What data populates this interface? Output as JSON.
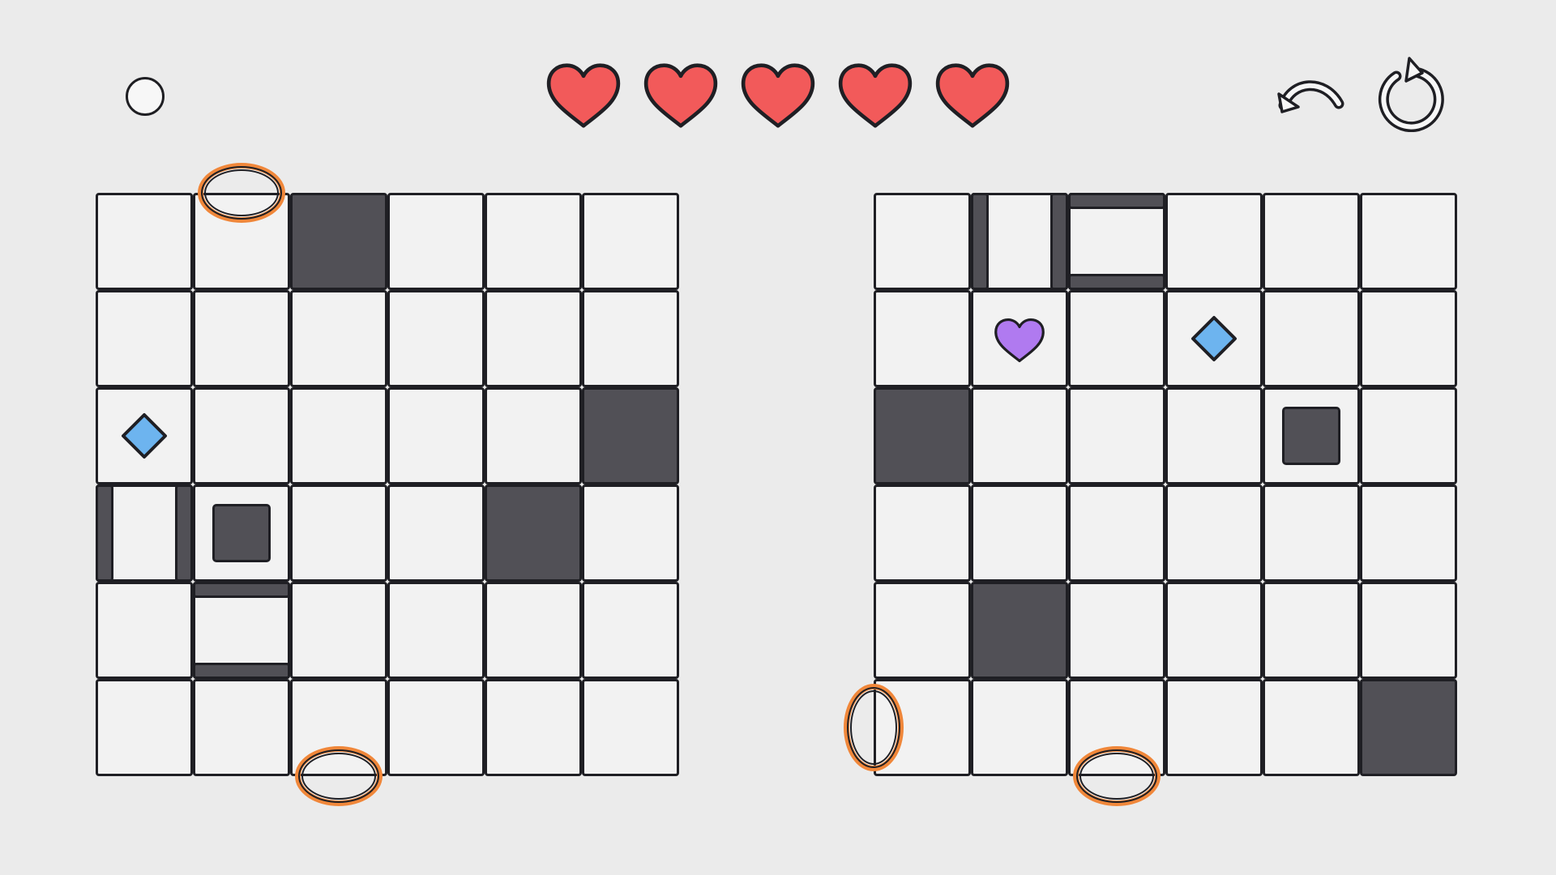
{
  "hud": {
    "indicator": "state-indicator",
    "lives": {
      "count": 5,
      "color": "#f25a5a",
      "icon": "heart-icon"
    },
    "undo": {
      "icon": "undo-icon"
    },
    "restart": {
      "icon": "restart-icon"
    }
  },
  "colors": {
    "background": "#ebebeb",
    "cell": "#f2f2f2",
    "dark_cell": "#515056",
    "outline": "#1f1f24",
    "portal": "#f0873a",
    "gem": "#6db4ef",
    "purple_heart": "#b07af0"
  },
  "boards": [
    {
      "rows": 6,
      "cols": 6,
      "dark_cells": [
        [
          0,
          2
        ],
        [
          2,
          5
        ],
        [
          3,
          4
        ]
      ],
      "boxes": [
        [
          3,
          1
        ]
      ],
      "gems": [
        [
          2,
          0
        ]
      ],
      "hearts": [],
      "walls": [
        {
          "row": 3,
          "col": 0,
          "side": "left"
        },
        {
          "row": 3,
          "col": 0,
          "side": "right"
        },
        {
          "row": 4,
          "col": 1,
          "side": "top"
        },
        {
          "row": 4,
          "col": 1,
          "side": "bottom"
        }
      ],
      "portals": [
        {
          "row": 0,
          "col": 1,
          "edge": "top"
        },
        {
          "row": 5,
          "col": 2,
          "edge": "bottom"
        }
      ]
    },
    {
      "rows": 6,
      "cols": 6,
      "dark_cells": [
        [
          2,
          0
        ],
        [
          4,
          1
        ],
        [
          5,
          5
        ]
      ],
      "boxes": [
        [
          2,
          4
        ]
      ],
      "gems": [
        [
          1,
          3
        ]
      ],
      "hearts": [
        [
          1,
          1
        ]
      ],
      "walls": [
        {
          "row": 0,
          "col": 1,
          "side": "left"
        },
        {
          "row": 0,
          "col": 1,
          "side": "right"
        },
        {
          "row": 0,
          "col": 2,
          "side": "top"
        },
        {
          "row": 0,
          "col": 2,
          "side": "bottom"
        }
      ],
      "portals": [
        {
          "row": 5,
          "col": 0,
          "edge": "left"
        },
        {
          "row": 5,
          "col": 2,
          "edge": "bottom"
        }
      ]
    }
  ]
}
